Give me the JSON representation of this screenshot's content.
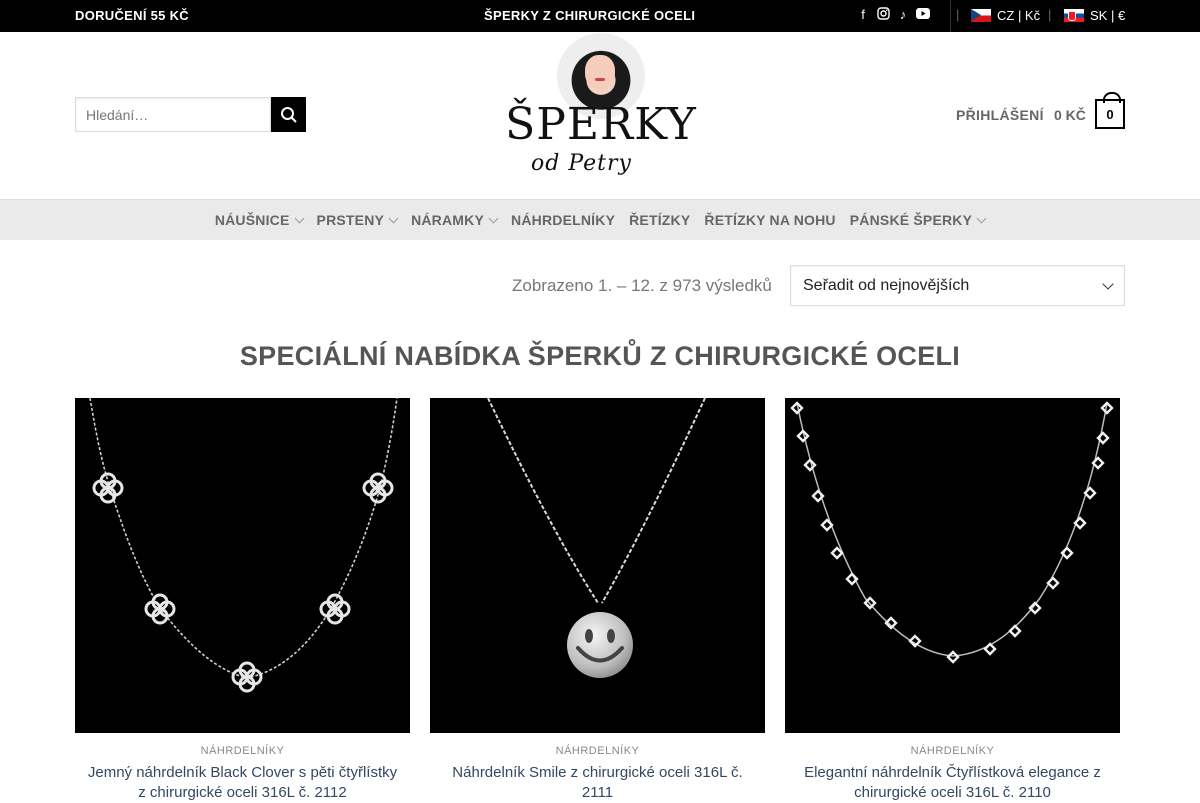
{
  "topbar": {
    "shipping": "DORUČENÍ 55 KČ",
    "promo": " ŠPERKY Z CHIRURGICKÉ OCELI ",
    "social_icons": [
      "facebook-icon",
      "instagram-icon",
      "tiktok-icon",
      "youtube-icon"
    ],
    "lang_cz": "CZ | Kč",
    "lang_sk": "SK | €"
  },
  "header": {
    "search_placeholder": "Hledání…",
    "logo_text": "ŠPERKY",
    "logo_sub": "od Petry",
    "account_label": "PŘIHLÁŠENÍ",
    "cart_total": "0 KČ",
    "cart_count": "0"
  },
  "nav": {
    "items": [
      {
        "label": "NÁUŠNICE",
        "dropdown": true
      },
      {
        "label": "PRSTENY",
        "dropdown": true
      },
      {
        "label": "NÁRAMKY",
        "dropdown": true
      },
      {
        "label": "NÁHRDELNÍKY",
        "dropdown": false
      },
      {
        "label": "ŘETÍZKY",
        "dropdown": false
      },
      {
        "label": "ŘETÍZKY NA NOHU",
        "dropdown": false
      },
      {
        "label": "PÁNSKÉ ŠPERKY",
        "dropdown": true
      }
    ]
  },
  "results": {
    "count_text": "Zobrazeno 1. – 12. z 973 výsledků",
    "sort_selected": "Seřadit od nejnovějších"
  },
  "section_title": "SPECIÁLNÍ NABÍDKA ŠPERKŮ Z CHIRURGICKÉ OCELI",
  "products": [
    {
      "category": "NÁHRDELNÍKY",
      "title": "Jemný náhrdelník Black Clover s pěti čtyřlístky z chirurgické oceli 316L č. 2112"
    },
    {
      "category": "NÁHRDELNÍKY",
      "title": "Náhrdelník Smile z chirurgické oceli 316L č. 2111"
    },
    {
      "category": "NÁHRDELNÍKY",
      "title": "Elegantní náhrdelník Čtyřlístková elegance z chirurgické oceli 316L č. 2110"
    }
  ],
  "colors": {
    "topbar_bg": "#000000",
    "nav_bg": "#eaeaea",
    "product_title": "#334862"
  }
}
